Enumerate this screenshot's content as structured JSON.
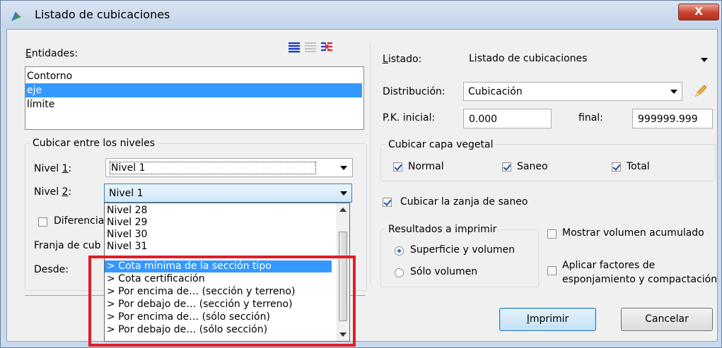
{
  "window": {
    "title": "Listado de cubicaciones",
    "close_label": "X"
  },
  "entidades": {
    "label_prefix": "E",
    "label_rest": "ntidades:",
    "items": [
      {
        "label": "Contorno",
        "selected": false
      },
      {
        "label": "eje",
        "selected": true
      },
      {
        "label": "límite",
        "selected": false
      }
    ]
  },
  "niveles": {
    "group_title": "Cubicar entre los niveles",
    "nivel1_prefix": "Nivel ",
    "nivel1_key": "1",
    "nivel1_suffix": ":",
    "nivel1_value": "Nivel 1",
    "nivel2_prefix": "Nivel ",
    "nivel2_key": "2",
    "nivel2_suffix": ":",
    "nivel2_value": "Nivel 1",
    "diferencia_label": "Diferencia",
    "franja_label": "Franja de cub",
    "desde_label": "Desde:"
  },
  "dropdown": {
    "items": [
      {
        "label": "Nivel 28",
        "selected": false
      },
      {
        "label": "Nivel 29",
        "selected": false
      },
      {
        "label": "Nivel 30",
        "selected": false
      },
      {
        "label": "Nivel 31",
        "selected": false
      },
      {
        "label": "> Cota mínima de la sección tipo",
        "selected": true
      },
      {
        "label": "> Cota certificación",
        "selected": false
      },
      {
        "label": "> Por encima de… (sección y terreno)",
        "selected": false
      },
      {
        "label": "> Por debajo de… (sección y terreno)",
        "selected": false
      },
      {
        "label": "> Por encima de… (sólo sección)",
        "selected": false
      },
      {
        "label": "> Por debajo de… (sólo sección)",
        "selected": false
      }
    ]
  },
  "listado": {
    "label_prefix": "L",
    "label_rest": "istado:",
    "value": "Listado de cubicaciones"
  },
  "distribucion": {
    "label": "Distribución:",
    "value": "Cubicación"
  },
  "pk": {
    "inicial_label": "P.K. inicial:",
    "inicial_value": "0.000",
    "final_label": "final:",
    "final_value": "999999.999"
  },
  "capa_vegetal": {
    "group_title": "Cubicar capa vegetal",
    "normal": {
      "label": "Normal",
      "checked": true
    },
    "saneo": {
      "label": "Saneo",
      "checked": true
    },
    "total": {
      "label": "Total",
      "checked": true
    }
  },
  "zanja": {
    "label": "Cubicar la zanja de saneo",
    "checked": true
  },
  "resultados": {
    "group_title": "Resultados a imprimir",
    "superficie": {
      "label": "Superficie y volumen",
      "selected": true
    },
    "volumen": {
      "label": "Sólo volumen",
      "selected": false
    }
  },
  "mostrar_acumulado": {
    "label": "Mostrar volumen acumulado",
    "checked": false
  },
  "factores": {
    "line1": "Aplicar factores de",
    "line2": "esponjamiento y compactación",
    "checked": false
  },
  "buttons": {
    "imprimir_key": "I",
    "imprimir_rest": "mprimir",
    "cancelar": "Cancelar"
  },
  "colors": {
    "selection": "#3399ff",
    "highlight_box": "#e01e26",
    "title_bar": "#c9d9ec"
  }
}
